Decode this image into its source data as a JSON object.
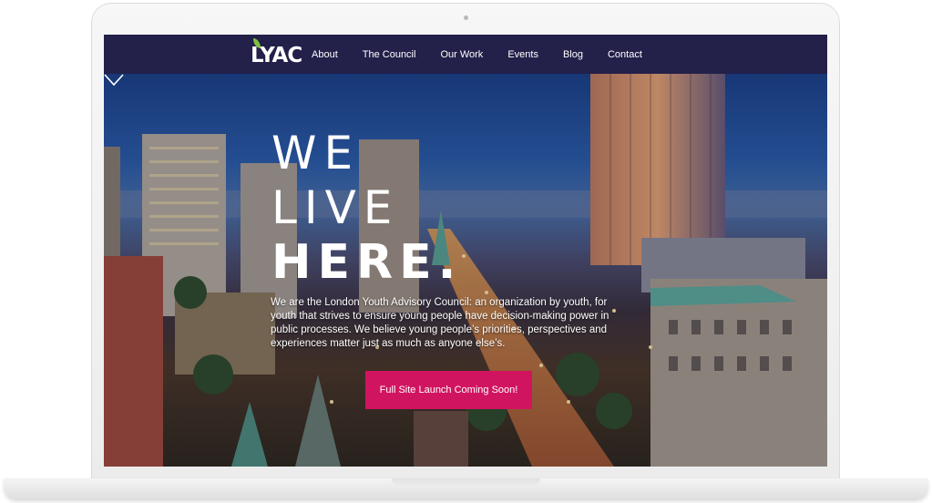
{
  "navbar": {
    "logo_text": "LYAC",
    "items": [
      {
        "label": "About"
      },
      {
        "label": "The Council"
      },
      {
        "label": "Our Work"
      },
      {
        "label": "Events"
      },
      {
        "label": "Blog"
      },
      {
        "label": "Contact"
      }
    ]
  },
  "hero": {
    "headline_line1": "WE",
    "headline_line2": "LIVE",
    "headline_line3": "HERE.",
    "intro": "We are the London Youth Advisory Council: an organization by youth, for youth that strives to ensure young people have decision-making power in public processes. We believe young people’s priorities, perspectives and experiences matter just as much as anyone else’s.",
    "cta_label": "Full Site Launch Coming Soon!",
    "scroll_icon": "chevron-down-icon"
  },
  "colors": {
    "navbar_bg": "#23204a",
    "cta_bg": "#d1145f",
    "logo_leaf": "#7ec242"
  }
}
